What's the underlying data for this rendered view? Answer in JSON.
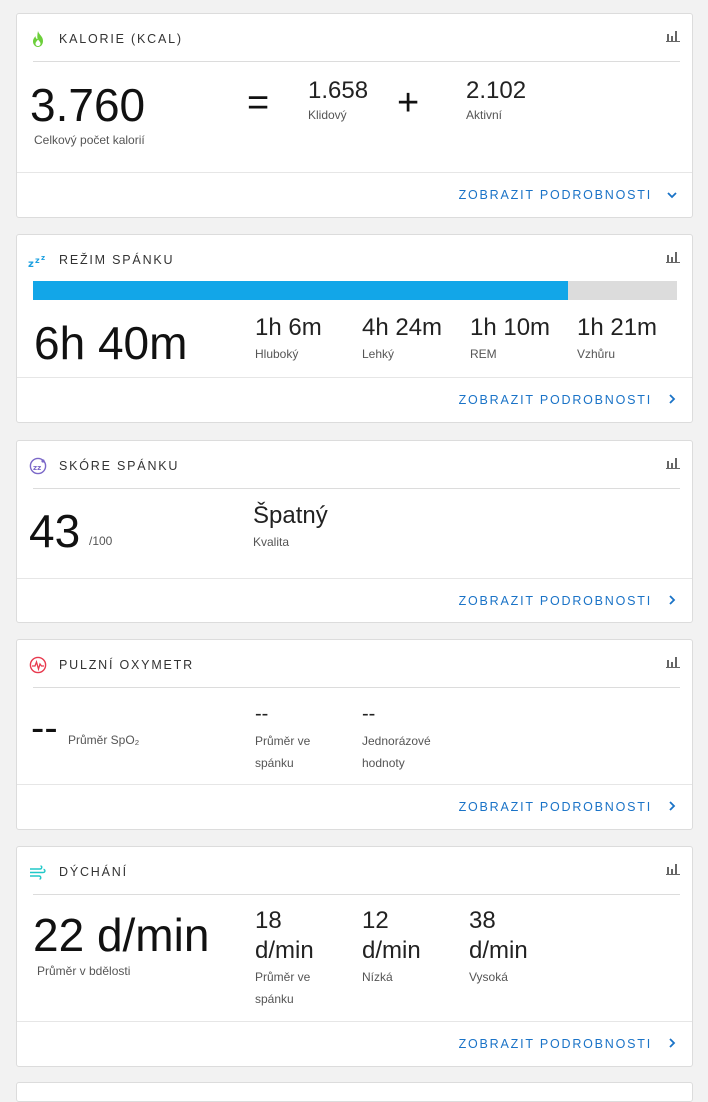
{
  "colors": {
    "accent": "#1a73c7",
    "sleep_bar": "#12a6e8",
    "calories_icon": "#6ccf3a",
    "sleep_icon": "#1ca0e0",
    "score_icon": "#7b68c8",
    "pulse_icon": "#e8394e",
    "breath_icon": "#21c8c8"
  },
  "details_label": "ZOBRAZIT PODROBNOSTI",
  "calories": {
    "title": "KALORIE (KCAL)",
    "total": "3.760",
    "total_label": "Celkový počet kalorií",
    "equals": "=",
    "resting": "1.658",
    "resting_label": "Klidový",
    "plus": "+",
    "active": "2.102",
    "active_label": "Aktivní"
  },
  "sleep": {
    "title": "REŽIM SPÁNKU",
    "total": "6h 40m",
    "progress_fraction": 0.83,
    "stages": [
      {
        "value": "1h 6m",
        "label": "Hluboký"
      },
      {
        "value": "4h 24m",
        "label": "Lehký"
      },
      {
        "value": "1h 10m",
        "label": "REM"
      },
      {
        "value": "1h 21m",
        "label": "Vzhůru"
      }
    ]
  },
  "score": {
    "title": "SKÓRE SPÁNKU",
    "value": "43",
    "max": "/100",
    "quality": "Špatný",
    "quality_label": "Kvalita"
  },
  "pulse": {
    "title": "PULZNÍ OXYMETR",
    "avg": "--",
    "avg_label": "Průměr SpO₂",
    "sleep_avg": "--",
    "sleep_avg_label_1": "Průměr ve",
    "sleep_avg_label_2": "spánku",
    "single": "--",
    "single_label_1": "Jednorázové",
    "single_label_2": "hodnoty"
  },
  "breathing": {
    "title": "DÝCHÁNÍ",
    "awake": "22 d/min",
    "awake_label": "Průměr v bdělosti",
    "sleep_value": "18",
    "sleep_unit": "d/min",
    "sleep_label_1": "Průměr ve",
    "sleep_label_2": "spánku",
    "low_value": "12",
    "low_unit": "d/min",
    "low_label": "Nízká",
    "high_value": "38",
    "high_unit": "d/min",
    "high_label": "Vysoká"
  }
}
